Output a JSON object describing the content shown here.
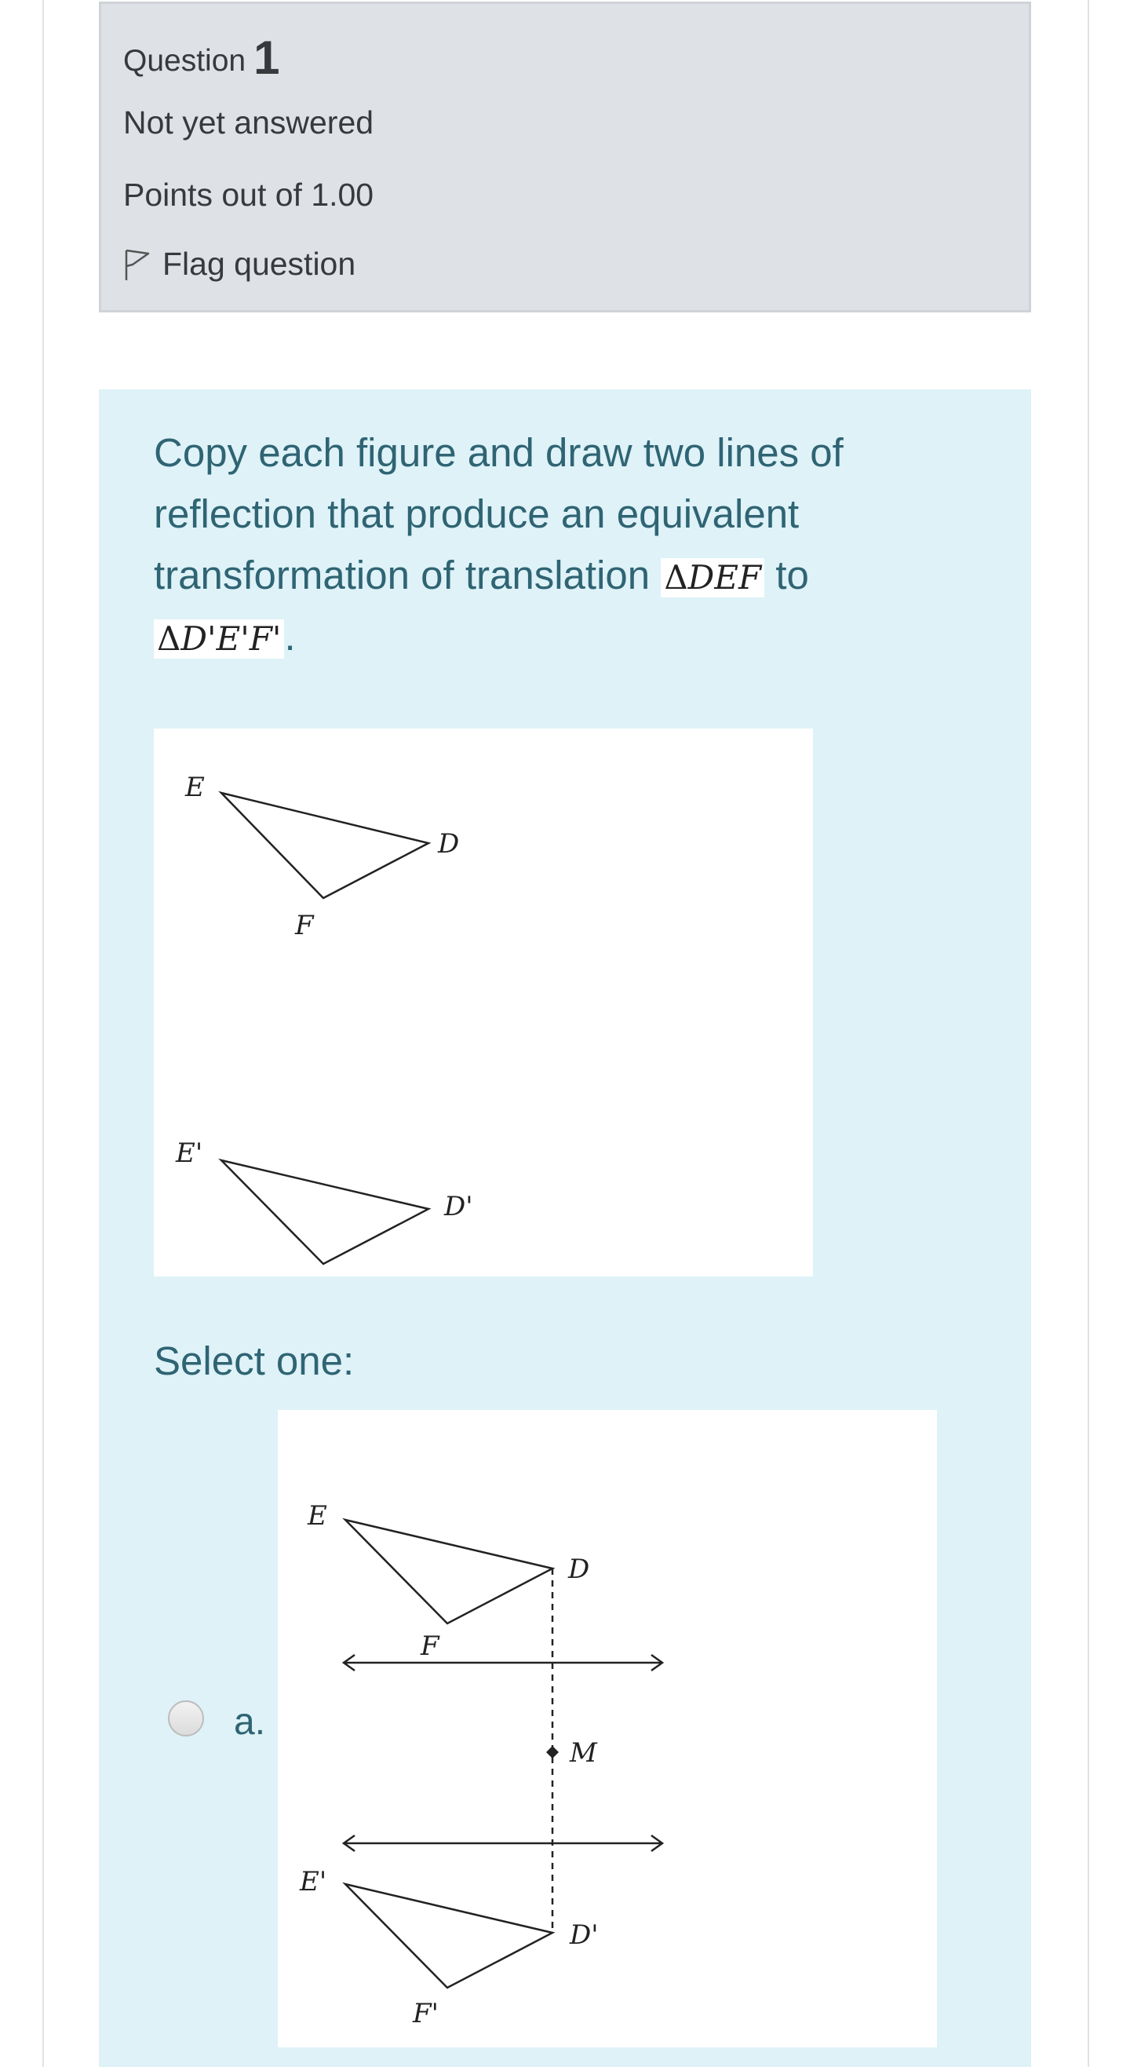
{
  "question": {
    "label": "Question",
    "number": "1",
    "state": "Not yet answered",
    "grade": "Points out of 1.00",
    "flag_label": "Flag question"
  },
  "content": {
    "text_part1": "Copy each figure and draw two lines of reflection that produce an equivalent transformation of translation ",
    "math1_symbol": "Δ",
    "math1_letters": "DEF",
    "text_part2": " to ",
    "math2_symbol": "Δ",
    "math2_letters": "D'E'F'",
    "text_end": ".",
    "figure_labels": {
      "E": "E",
      "D": "D",
      "F": "F",
      "E2": "E'",
      "D2": "D'"
    }
  },
  "prompt": "Select one:",
  "options": [
    {
      "letter": "a.",
      "figure_labels": {
        "E": "E",
        "D": "D",
        "F": "F",
        "M": "M",
        "E2": "E'",
        "D2": "D'",
        "F2": "F'"
      }
    }
  ],
  "colors": {
    "info_bg": "#dee2e6",
    "formulation_bg": "#def2f8",
    "text": "#2f6473"
  }
}
